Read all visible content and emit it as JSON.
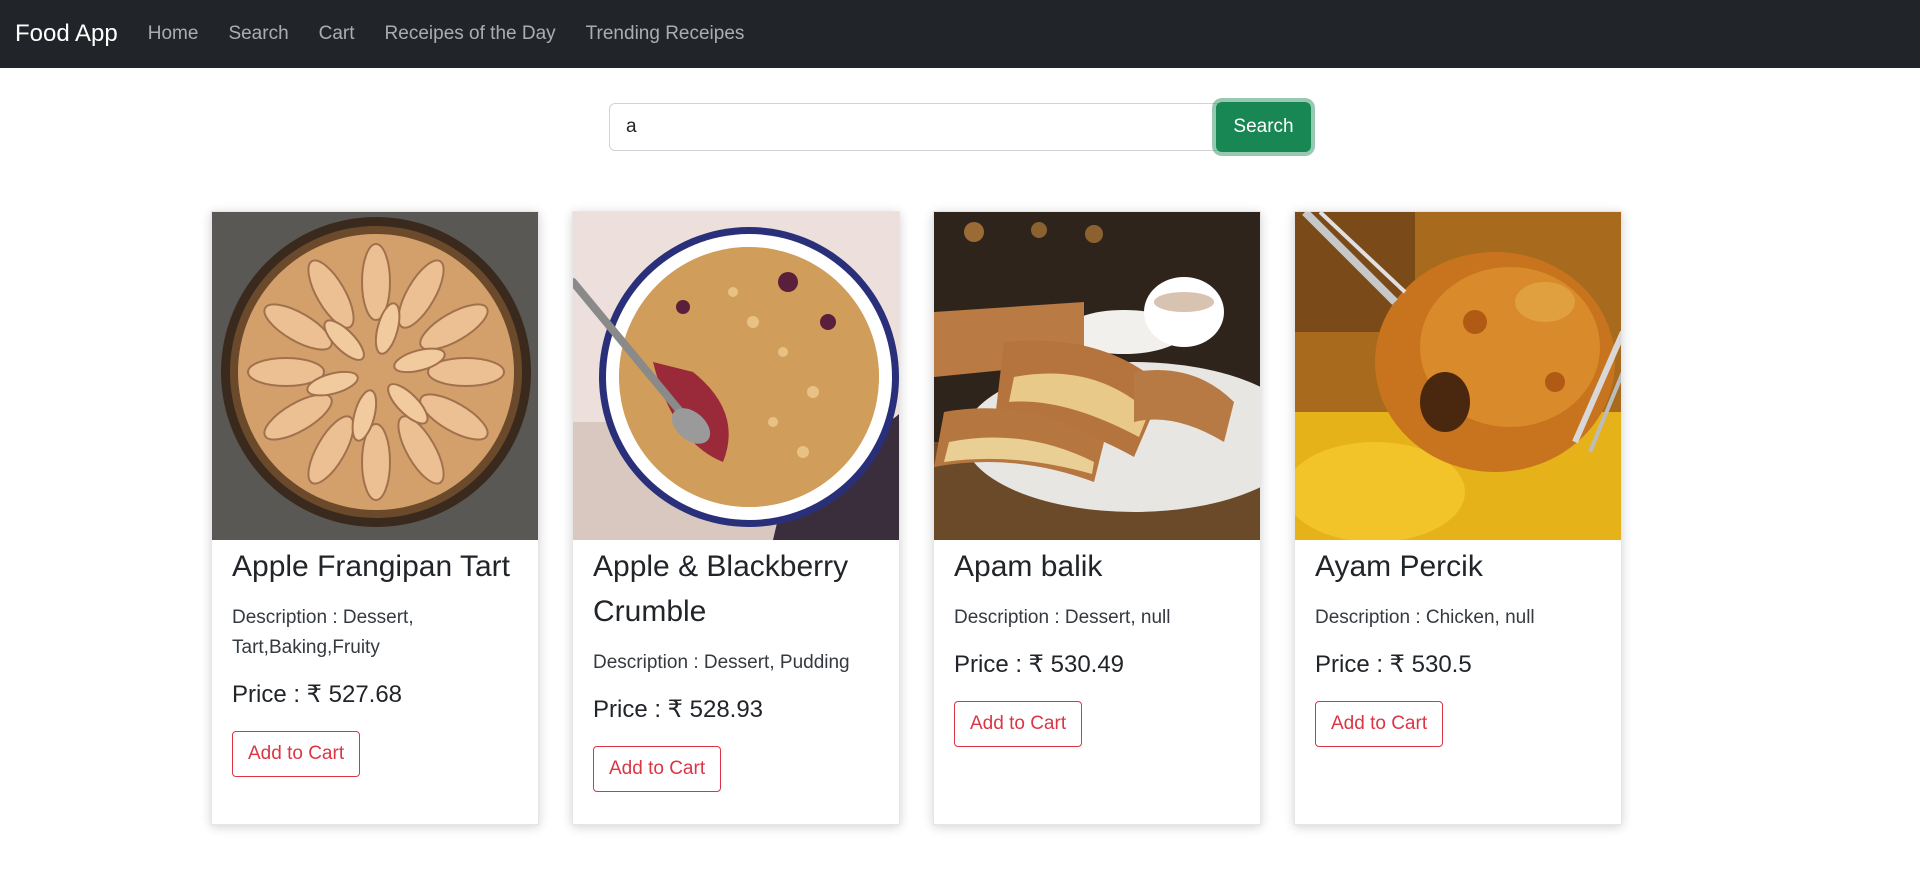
{
  "nav": {
    "brand": "Food App",
    "links": [
      "Home",
      "Search",
      "Cart",
      "Receipes of the Day",
      "Trending Receipes"
    ]
  },
  "search": {
    "value": "a",
    "button_label": "Search"
  },
  "cards": [
    {
      "title": "Apple Frangipan Tart",
      "description": "Description : Dessert, Tart,Baking,Fruity",
      "price": "Price : ₹ 527.68",
      "button_label": "Add to Cart",
      "image": "tart"
    },
    {
      "title": "Apple & Blackberry Crumble",
      "description": "Description : Dessert, Pudding",
      "price": "Price : ₹ 528.93",
      "button_label": "Add to Cart",
      "image": "crumble"
    },
    {
      "title": "Apam balik",
      "description": "Description : Dessert, null",
      "price": "Price : ₹ 530.49",
      "button_label": "Add to Cart",
      "image": "pancake"
    },
    {
      "title": "Ayam Percik",
      "description": "Description : Chicken, null",
      "price": "Price : ₹ 530.5",
      "button_label": "Add to Cart",
      "image": "chicken"
    }
  ],
  "colors": {
    "navbar": "#212529",
    "search_button": "#198754",
    "add_to_cart": "#dc3545"
  }
}
